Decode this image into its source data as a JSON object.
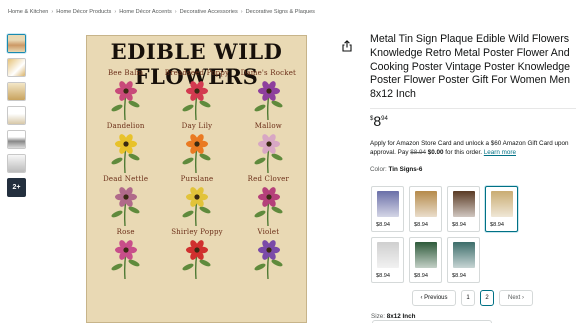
{
  "breadcrumb": [
    "Home & Kitchen",
    "Home Décor Products",
    "Home Décor Accents",
    "Decorative Accessories",
    "Decorative Signs & Plaques"
  ],
  "breadcrumb_separator": "›",
  "thumbnails": {
    "more_label": "2+"
  },
  "poster": {
    "title": "EDIBLE WILD FLOWERS",
    "flowers": [
      "Bee Balm",
      "Breadseed Poppy",
      "Dame's Rocket",
      "Dandelion",
      "Day Lily",
      "Mallow",
      "Dead Nettle",
      "Purslane",
      "Red Clover",
      "Rose",
      "Shirley Poppy",
      "Violet"
    ],
    "flower_colors": [
      "#c84a7a",
      "#d33a50",
      "#8e3f9d",
      "#e8c22a",
      "#ea7a22",
      "#d8a7c4",
      "#b06a8a",
      "#e2c33a",
      "#b5407a",
      "#c84e8a",
      "#d0302f",
      "#7a4aa8"
    ]
  },
  "icons": {
    "share": "share-icon"
  },
  "product": {
    "title": "Metal Tin Sign Plaque Edible Wild Flowers Knowledge Retro Metal Poster Flower And Cooking Poster Vintage Poster Knowledge Poster Flower Poster Gift For Women Men 8x12 Inch",
    "price_currency": "$",
    "price_whole": "8",
    "price_fraction": "94"
  },
  "offer": {
    "text1": "Apply for Amazon Store Card and unlock a $60 Amazon Gift Card upon approval. Pay ",
    "old_price": "$8.94",
    "new_price": "$0.00",
    "text2": " for this order. ",
    "link": "Learn more"
  },
  "color": {
    "label": "Color: ",
    "value": "Tin Signs-6"
  },
  "swatches": [
    {
      "price": "$8.94",
      "color": "#6a6fa8",
      "selected": false
    },
    {
      "price": "$8.94",
      "color": "#b58a4a",
      "selected": false
    },
    {
      "price": "$8.94",
      "color": "#5a3a24",
      "selected": false
    },
    {
      "price": "$8.94",
      "color": "#c9ac72",
      "selected": true
    },
    {
      "price": "$8.94",
      "color": "#cfcfcf",
      "selected": false
    },
    {
      "price": "$8.94",
      "color": "#2e5a3a",
      "selected": false
    },
    {
      "price": "$8.94",
      "color": "#3c6d6a",
      "selected": false
    }
  ],
  "pagination": {
    "previous": "Previous",
    "page1": "1",
    "page2": "2",
    "next": "Next"
  },
  "size": {
    "label": "Size: ",
    "value": "8x12 Inch"
  }
}
